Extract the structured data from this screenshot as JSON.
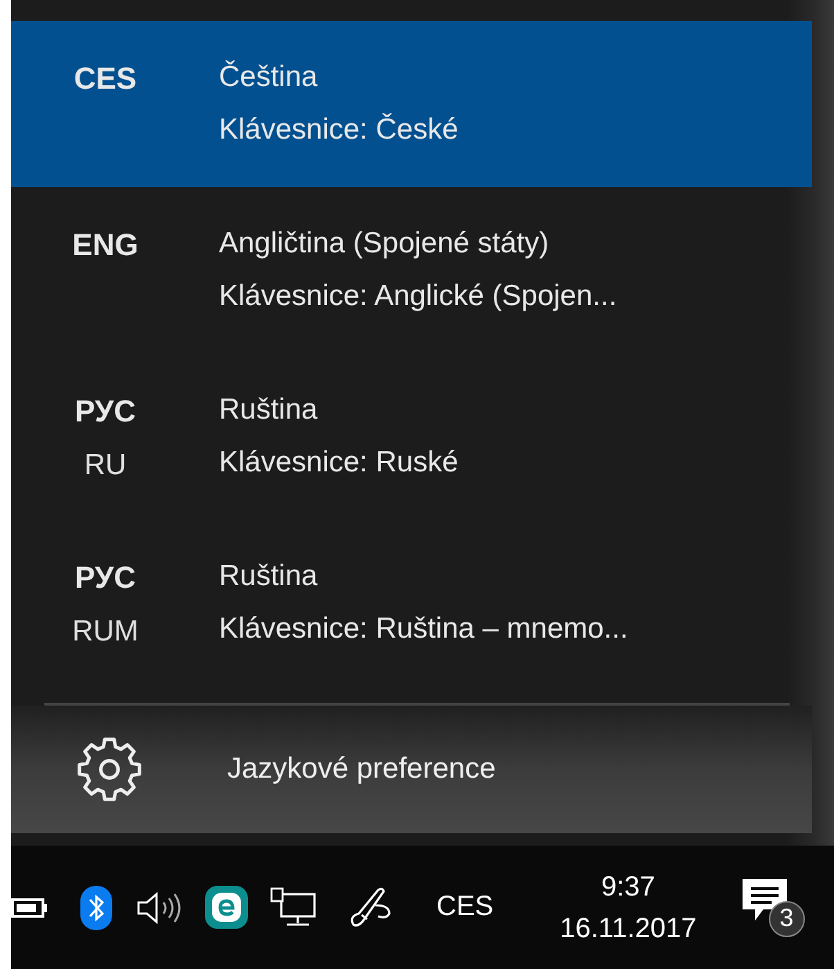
{
  "languages": [
    {
      "code": "CES",
      "name": "Čeština",
      "keyboard": "Klávesnice: České",
      "selected": true
    },
    {
      "code": "ENG",
      "name": "Angličtina (Spojené státy)",
      "keyboard": "Klávesnice: Anglické (Spojen...",
      "selected": false
    },
    {
      "code": "РУС",
      "variant": "RU",
      "name": "Ruština",
      "keyboard": "Klávesnice: Ruské",
      "selected": false
    },
    {
      "code": "РУС",
      "variant": "RUM",
      "name": "Ruština",
      "keyboard": "Klávesnice: Ruština – mnemo...",
      "selected": false
    }
  ],
  "settings": {
    "label": "Jazykové preference"
  },
  "taskbar": {
    "input_indicator": "CES",
    "time": "9:37",
    "date": "16.11.2017",
    "notification_count": "3"
  }
}
